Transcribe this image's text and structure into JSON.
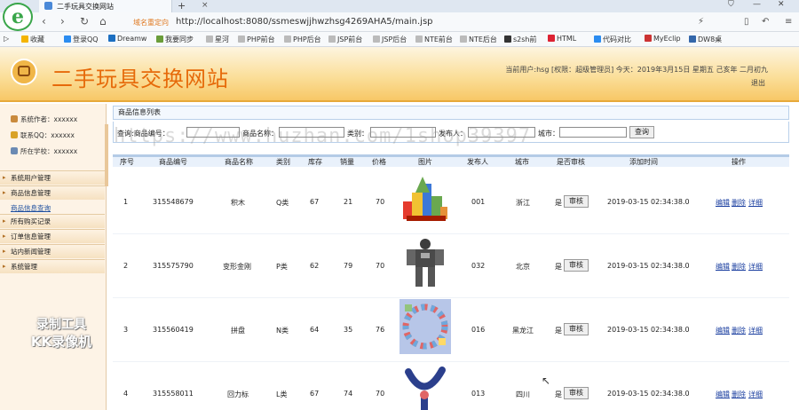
{
  "browser": {
    "tab_title": "二手玩具交换网站",
    "close_tab": "×",
    "new_tab": "+",
    "back": "‹",
    "forward": "›",
    "reload": "↻",
    "home": "⌂",
    "secure_hint": "域名重定向",
    "url": "http://localhost:8080/ssmeswjjhwzhsg4269AHA5/main.jsp",
    "bookmarks": [
      "收藏",
      "登录QQ",
      "Dreamw",
      "我要同步",
      "星河",
      "PHP前台",
      "PHP后台",
      "JSP前台",
      "JSP后台",
      "NTE前台",
      "NTE后台",
      "s2sh前",
      "HTML",
      "代码对比",
      "MyEclip",
      "DW8桌"
    ]
  },
  "header": {
    "title": "二手玩具交换网站",
    "userinfo": "当前用户:hsg [权限：超级管理员]  今天：2019年3月15日 星期五 己亥年 二月初九",
    "logout": "退出"
  },
  "sidebar": {
    "info": [
      "系统作者：xxxxxx",
      "联系QQ：xxxxxx",
      "所在学校：xxxxxx"
    ],
    "menu": [
      "系统用户管理",
      "商品信息管理",
      "所有购买记录",
      "订单信息管理",
      "站内新闻管理",
      "系统管理"
    ],
    "submenu": "商品信息查询",
    "rec_line1": "录制工具",
    "rec_line2": "KK录像机"
  },
  "main": {
    "panel_title": "商品信息列表",
    "search": {
      "label_code": "查询:商品编号：",
      "label_name": "商品名称：",
      "label_category": "类别：",
      "label_publisher": "发布人：",
      "label_city": "城市：",
      "button": "查询"
    },
    "columns": [
      "序号",
      "商品编号",
      "商品名称",
      "类别",
      "库存",
      "销量",
      "价格",
      "图片",
      "发布人",
      "城市",
      "是否审核",
      "添加时间",
      "操作"
    ],
    "rows": [
      {
        "no": "1",
        "code": "315548679",
        "name": "积木",
        "cat": "Q类",
        "stock": "67",
        "sales": "21",
        "price": "70",
        "pub": "001",
        "city": "浙江",
        "audit": "是",
        "time": "2019-03-15 02:34:38.0"
      },
      {
        "no": "2",
        "code": "315575790",
        "name": "变形金刚",
        "cat": "P类",
        "stock": "62",
        "sales": "79",
        "price": "70",
        "pub": "032",
        "city": "北京",
        "audit": "是",
        "time": "2019-03-15 02:34:38.0"
      },
      {
        "no": "3",
        "code": "315560419",
        "name": "拼盘",
        "cat": "N类",
        "stock": "64",
        "sales": "35",
        "price": "76",
        "pub": "016",
        "city": "黑龙江",
        "audit": "是",
        "time": "2019-03-15 02:34:38.0"
      },
      {
        "no": "4",
        "code": "315558011",
        "name": "回力标",
        "cat": "L类",
        "stock": "67",
        "sales": "74",
        "price": "70",
        "pub": "013",
        "city": "四川",
        "audit": "是",
        "time": "2019-03-15 02:34:38.0"
      }
    ],
    "audit_button": "审核",
    "actions": [
      "编辑",
      "删除",
      "详细"
    ]
  },
  "watermark": "https://www.huzhan.com/1shop39397"
}
